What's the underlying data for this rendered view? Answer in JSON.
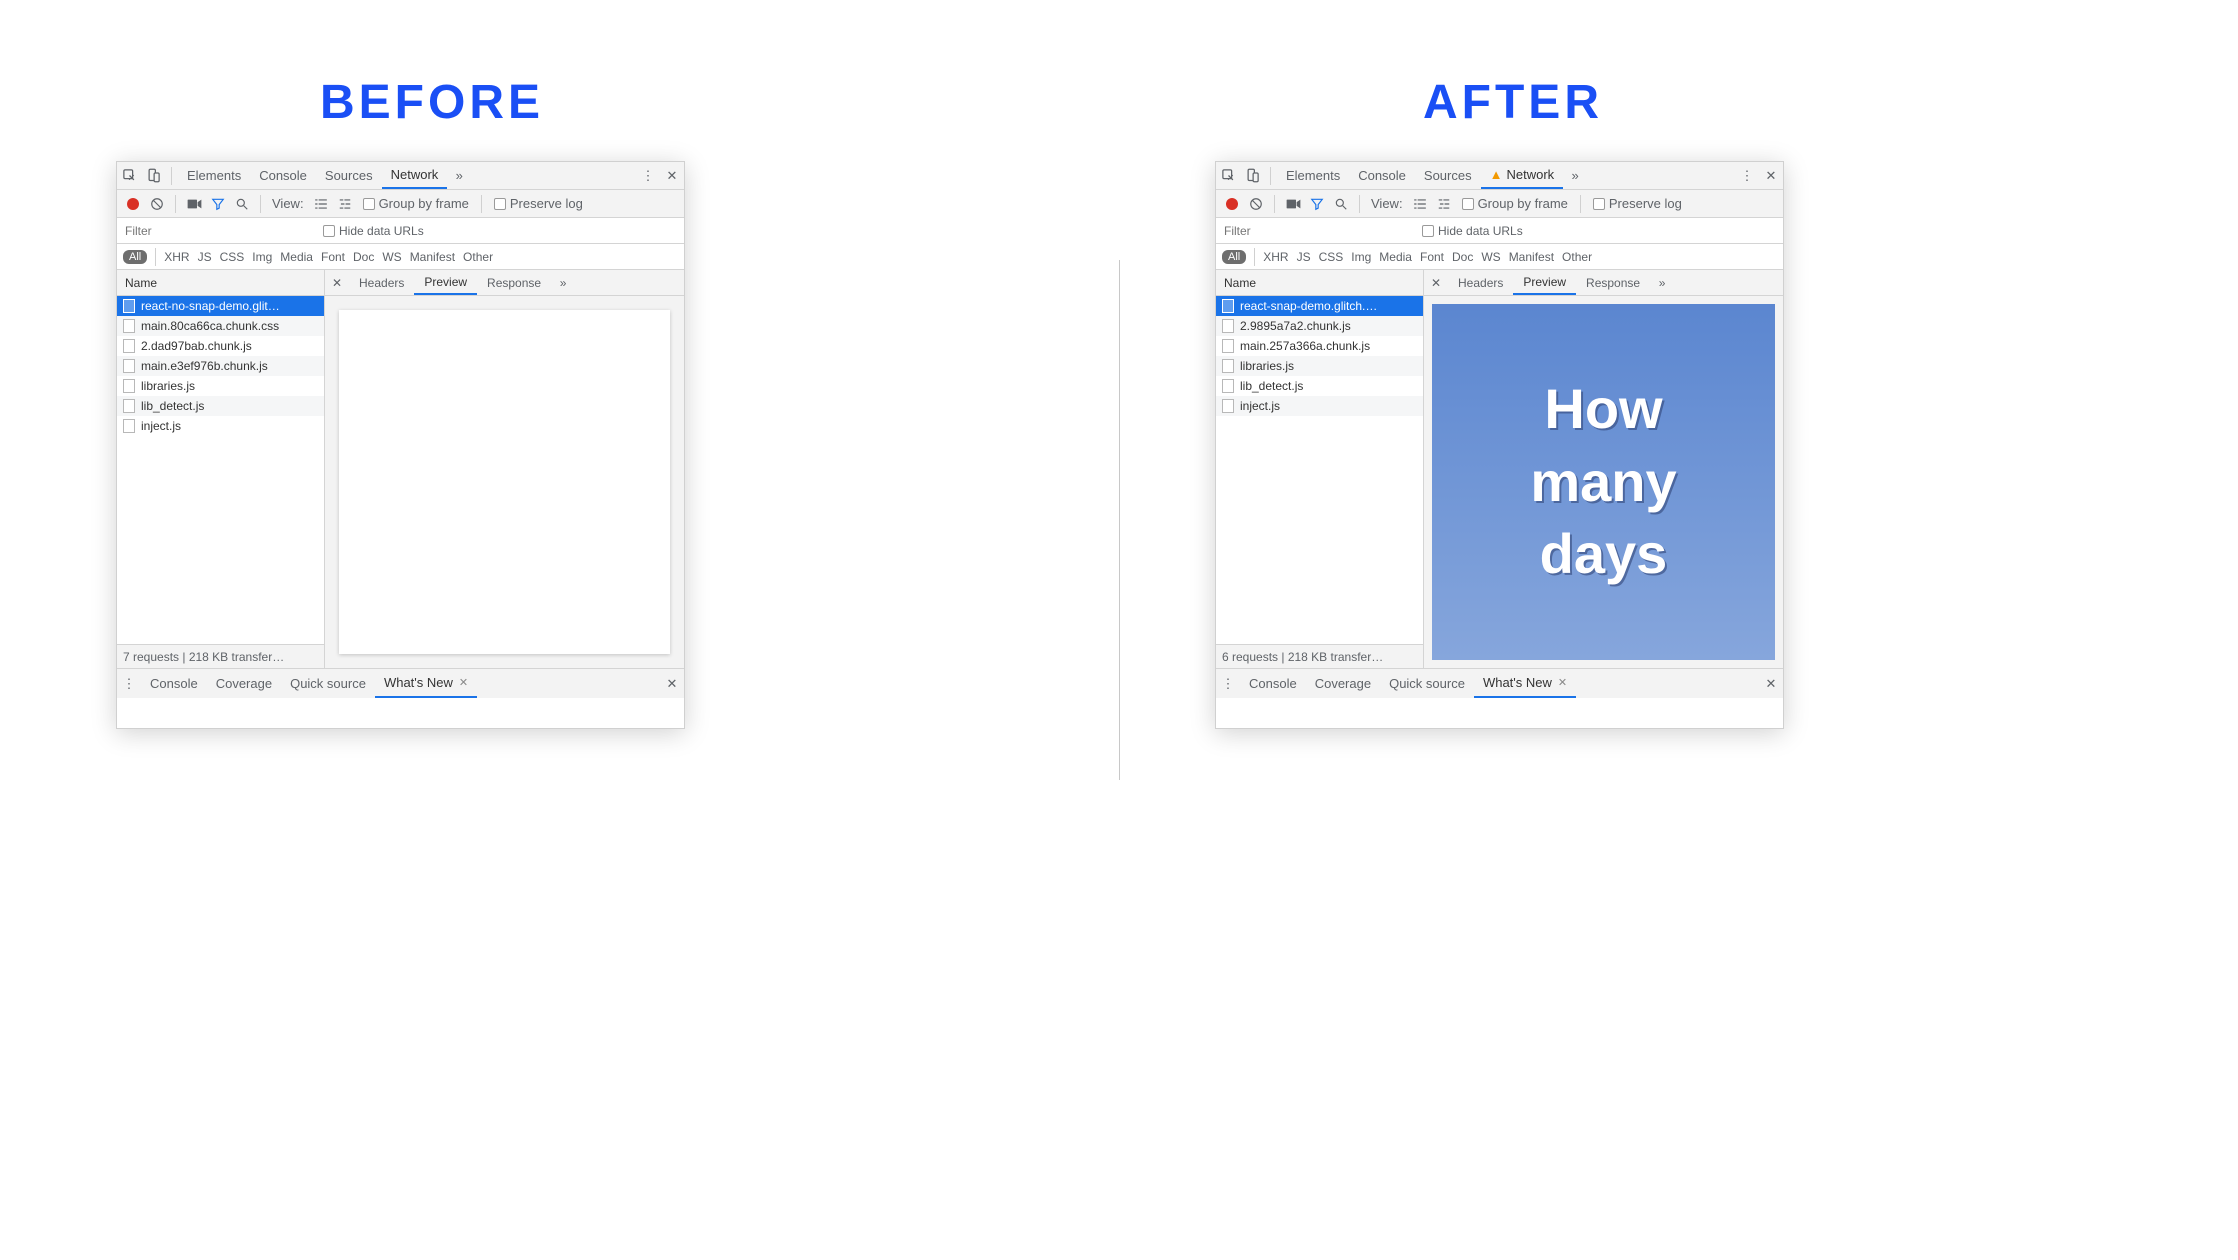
{
  "labels": {
    "before": "BEFORE",
    "after": "AFTER"
  },
  "top_tabs": {
    "elements": "Elements",
    "console": "Console",
    "sources": "Sources",
    "network": "Network"
  },
  "recbar": {
    "view": "View:",
    "group_by_frame": "Group by frame",
    "preserve_log": "Preserve log"
  },
  "filter": {
    "placeholder": "Filter",
    "hide_data_urls": "Hide data URLs"
  },
  "types": {
    "all": "All",
    "xhr": "XHR",
    "js": "JS",
    "css": "CSS",
    "img": "Img",
    "media": "Media",
    "font": "Font",
    "doc": "Doc",
    "ws": "WS",
    "manifest": "Manifest",
    "other": "Other"
  },
  "columns": {
    "name": "Name"
  },
  "detail_tabs": {
    "headers": "Headers",
    "preview": "Preview",
    "response": "Response"
  },
  "drawer": {
    "console": "Console",
    "coverage": "Coverage",
    "quick_source": "Quick source",
    "whats_new": "What's New"
  },
  "before": {
    "files": [
      "react-no-snap-demo.glit…",
      "main.80ca66ca.chunk.css",
      "2.dad97bab.chunk.js",
      "main.e3ef976b.chunk.js",
      "libraries.js",
      "lib_detect.js",
      "inject.js"
    ],
    "status": "7 requests | 218 KB transfer…"
  },
  "after": {
    "files": [
      "react-snap-demo.glitch.…",
      "2.9895a7a2.chunk.js",
      "main.257a366a.chunk.js",
      "libraries.js",
      "lib_detect.js",
      "inject.js"
    ],
    "status": "6 requests | 218 KB transfer…",
    "preview_lines": [
      "How",
      "many",
      "days"
    ]
  }
}
